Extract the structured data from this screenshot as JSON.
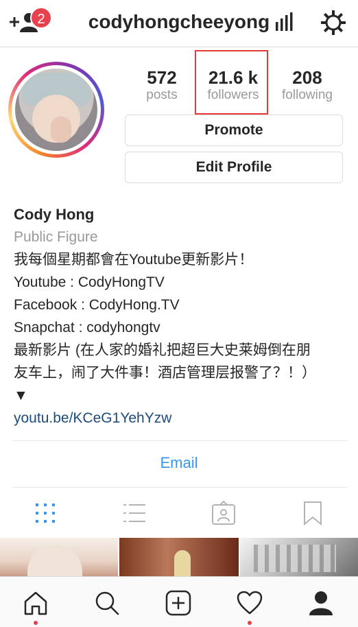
{
  "header": {
    "username": "codyhongcheeyong",
    "notification_count": "2",
    "icons": [
      "add-user-icon",
      "insights-icon",
      "gear-icon"
    ]
  },
  "stats": {
    "posts": {
      "value": "572",
      "label": "posts"
    },
    "followers": {
      "value": "21.6 k",
      "label": "followers"
    },
    "following": {
      "value": "208",
      "label": "following"
    }
  },
  "buttons": {
    "promote": "Promote",
    "edit_profile": "Edit Profile"
  },
  "bio": {
    "name": "Cody Hong",
    "category": "Public Figure",
    "lines": [
      "我每個星期都會在Youtube更新影片！",
      "Youtube : CodyHongTV",
      "Facebook : CodyHong.TV",
      "Snapchat : codyhongtv",
      "最新影片 (在人家的婚礼把超巨大史莱姆倒在朋",
      "友车上，闹了大件事！酒店管理层报警了？！）",
      "▼"
    ],
    "link": "youtu.be/KCeG1YehYzw"
  },
  "contact": {
    "email_label": "Email"
  },
  "tabs": [
    "grid-icon",
    "list-icon",
    "tagged-icon",
    "saved-icon"
  ],
  "bottom_nav": [
    "home-icon",
    "search-icon",
    "add-post-icon",
    "heart-icon",
    "profile-icon"
  ],
  "colors": {
    "accent": "#3897f0",
    "badge": "#e8414e",
    "highlight": "#e53935",
    "link": "#1e4b7a"
  }
}
